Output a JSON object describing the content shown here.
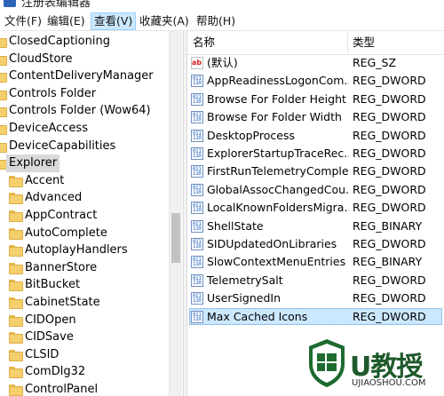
{
  "window": {
    "title": "注册表编辑器"
  },
  "menu": [
    {
      "label": "文件(F)"
    },
    {
      "label": "编辑(E)"
    },
    {
      "label": "查看(V)",
      "active": true
    },
    {
      "label": "收藏夹(A)"
    },
    {
      "label": "帮助(H)"
    }
  ],
  "tree": {
    "items": [
      {
        "label": "ClosedCaptioning",
        "level": 0
      },
      {
        "label": "CloudStore",
        "level": 0
      },
      {
        "label": "ContentDeliveryManager",
        "level": 0
      },
      {
        "label": "Controls Folder",
        "level": 0
      },
      {
        "label": "Controls Folder (Wow64)",
        "level": 0
      },
      {
        "label": "DeviceAccess",
        "level": 0
      },
      {
        "label": "DeviceCapabilities",
        "level": 0
      },
      {
        "label": "Explorer",
        "level": 0,
        "selected": true
      },
      {
        "label": "Accent",
        "level": 1
      },
      {
        "label": "Advanced",
        "level": 1
      },
      {
        "label": "AppContract",
        "level": 1
      },
      {
        "label": "AutoComplete",
        "level": 1
      },
      {
        "label": "AutoplayHandlers",
        "level": 1
      },
      {
        "label": "BannerStore",
        "level": 1
      },
      {
        "label": "BitBucket",
        "level": 1
      },
      {
        "label": "CabinetState",
        "level": 1
      },
      {
        "label": "CIDOpen",
        "level": 1
      },
      {
        "label": "CIDSave",
        "level": 1
      },
      {
        "label": "CLSID",
        "level": 1
      },
      {
        "label": "ComDlg32",
        "level": 1
      },
      {
        "label": "ControlPanel",
        "level": 1
      }
    ]
  },
  "list": {
    "columns": {
      "name": "名称",
      "type": "类型"
    },
    "rows": [
      {
        "name": "(默认)",
        "type": "REG_SZ",
        "icon": "string-value-icon"
      },
      {
        "name": "AppReadinessLogonCom...",
        "type": "REG_DWORD",
        "icon": "binary-value-icon"
      },
      {
        "name": "Browse For Folder Height",
        "type": "REG_DWORD",
        "icon": "binary-value-icon"
      },
      {
        "name": "Browse For Folder Width",
        "type": "REG_DWORD",
        "icon": "binary-value-icon"
      },
      {
        "name": "DesktopProcess",
        "type": "REG_DWORD",
        "icon": "binary-value-icon"
      },
      {
        "name": "ExplorerStartupTraceRec...",
        "type": "REG_DWORD",
        "icon": "binary-value-icon"
      },
      {
        "name": "FirstRunTelemetryComplete",
        "type": "REG_DWORD",
        "icon": "binary-value-icon"
      },
      {
        "name": "GlobalAssocChangedCou...",
        "type": "REG_DWORD",
        "icon": "binary-value-icon"
      },
      {
        "name": "LocalKnownFoldersMigra...",
        "type": "REG_DWORD",
        "icon": "binary-value-icon"
      },
      {
        "name": "ShellState",
        "type": "REG_BINARY",
        "icon": "binary-value-icon"
      },
      {
        "name": "SIDUpdatedOnLibraries",
        "type": "REG_DWORD",
        "icon": "binary-value-icon"
      },
      {
        "name": "SlowContextMenuEntries",
        "type": "REG_BINARY",
        "icon": "binary-value-icon"
      },
      {
        "name": "TelemetrySalt",
        "type": "REG_DWORD",
        "icon": "binary-value-icon"
      },
      {
        "name": "UserSignedIn",
        "type": "REG_DWORD",
        "icon": "binary-value-icon"
      },
      {
        "name": "Max Cached Icons",
        "type": "REG_DWORD",
        "icon": "binary-value-icon",
        "selected": true
      }
    ]
  },
  "watermark": {
    "brand": "U教授",
    "url": "UJIAOSHOU.COM"
  },
  "colors": {
    "selection": "#cce8ff",
    "tree_selection": "#d9d9d9",
    "folder": "#f5cf6b",
    "watermark_green": "#1e5a2b"
  }
}
